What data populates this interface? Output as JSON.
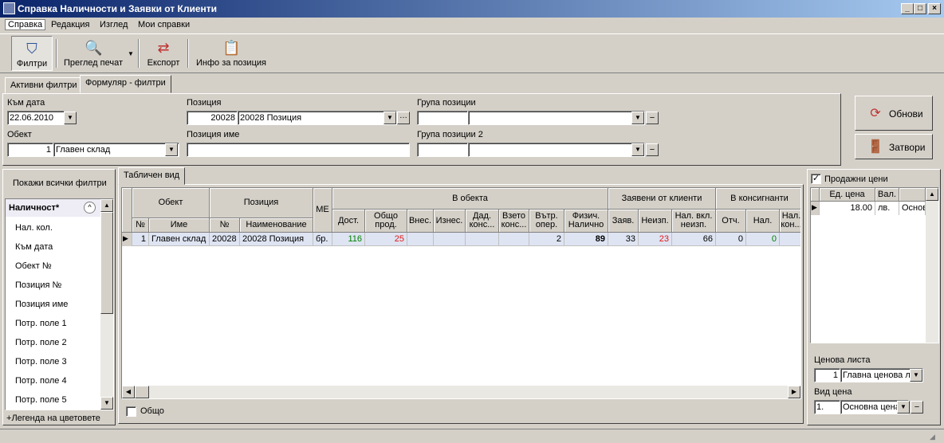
{
  "window": {
    "title": "Справка Наличности и Заявки от Клиенти"
  },
  "menu": [
    "Справка",
    "Редакция",
    "Изглед",
    "Мои справки"
  ],
  "toolbar": {
    "filters": "Филтри",
    "print_preview": "Преглед печат",
    "export": "Експорт",
    "item_info": "Инфо за позиция"
  },
  "tabs": {
    "active_filters": "Активни филтри",
    "form_filters": "Формуляр - филтри"
  },
  "form": {
    "to_date_label": "Към дата",
    "to_date_value": "22.06.2010",
    "item_label": "Позиция",
    "item_code": "20028",
    "item_value": "20028 Позиция",
    "item_group_label": "Група позиции",
    "object_label": "Обект",
    "object_code": "1",
    "object_value": "Главен склад",
    "item_name_label": "Позиция име",
    "item_group2_label": "Група позиции 2"
  },
  "buttons": {
    "refresh": "Обнови",
    "close": "Затвори"
  },
  "left": {
    "show_all": "Покажи всички филтри",
    "items": [
      "Наличност*",
      "Нал. кол.",
      "Към дата",
      "Обект №",
      "Позиция №",
      "Позиция име",
      "Потр. поле 1",
      "Потр. поле 2",
      "Потр. поле 3",
      "Потр. поле 4",
      "Потр. поле 5"
    ],
    "legend": "Легенда на цветовете"
  },
  "grid": {
    "tab": "Табличен вид",
    "group_headers": {
      "object": "Обект",
      "item": "Позиция",
      "unit": "МЕ",
      "in_object": "В обекта",
      "client_orders": "Заявени от клиенти",
      "consignees": "В консигнанти"
    },
    "sub_headers": {
      "obj_no": "№",
      "obj_name": "Име",
      "item_no": "№",
      "item_name": "Наименование",
      "deliv": "Дост.",
      "total_sales_1": "Общо",
      "total_sales_2": "прод.",
      "depos": "Внес.",
      "withdr": "Изнес.",
      "given_cons_1": "Дад.",
      "given_cons_2": "конс...",
      "taken_cons_1": "Взето",
      "taken_cons_2": "конс...",
      "internal_1": "Вътр.",
      "internal_2": "опер.",
      "physical_1": "Физич.",
      "physical_2": "Налично",
      "orders": "Заяв.",
      "unfulfilled": "Неизп.",
      "avail_incl_1": "Нал. вкл.",
      "avail_incl_2": "неизп.",
      "reported": "Отч.",
      "avail": "Нал.",
      "avail_cons_1": "Нал.",
      "avail_cons_2": "кон..."
    },
    "row": {
      "obj_no": "1",
      "obj_name": "Главен склад",
      "item_no": "20028",
      "item_name": "20028 Позиция",
      "unit": "бр.",
      "deliv": "116",
      "total_sales": "25",
      "internal": "2",
      "physical": "89",
      "orders": "33",
      "unfulfilled": "23",
      "avail_incl": "66",
      "reported": "0",
      "avail": "0"
    },
    "total_label": "Общо"
  },
  "right": {
    "sale_prices": "Продажни цени",
    "headers": {
      "unit_price": "Ед. цена",
      "currency": "Вал."
    },
    "row": {
      "price": "18.00",
      "currency": "лв.",
      "basis": "Основ"
    },
    "price_list_label": "Ценова листа",
    "price_list_code": "1",
    "price_list_value": "Главна ценова л",
    "price_type_label": "Вид цена",
    "price_type_code": "1.",
    "price_type_value": "Основна цена"
  }
}
